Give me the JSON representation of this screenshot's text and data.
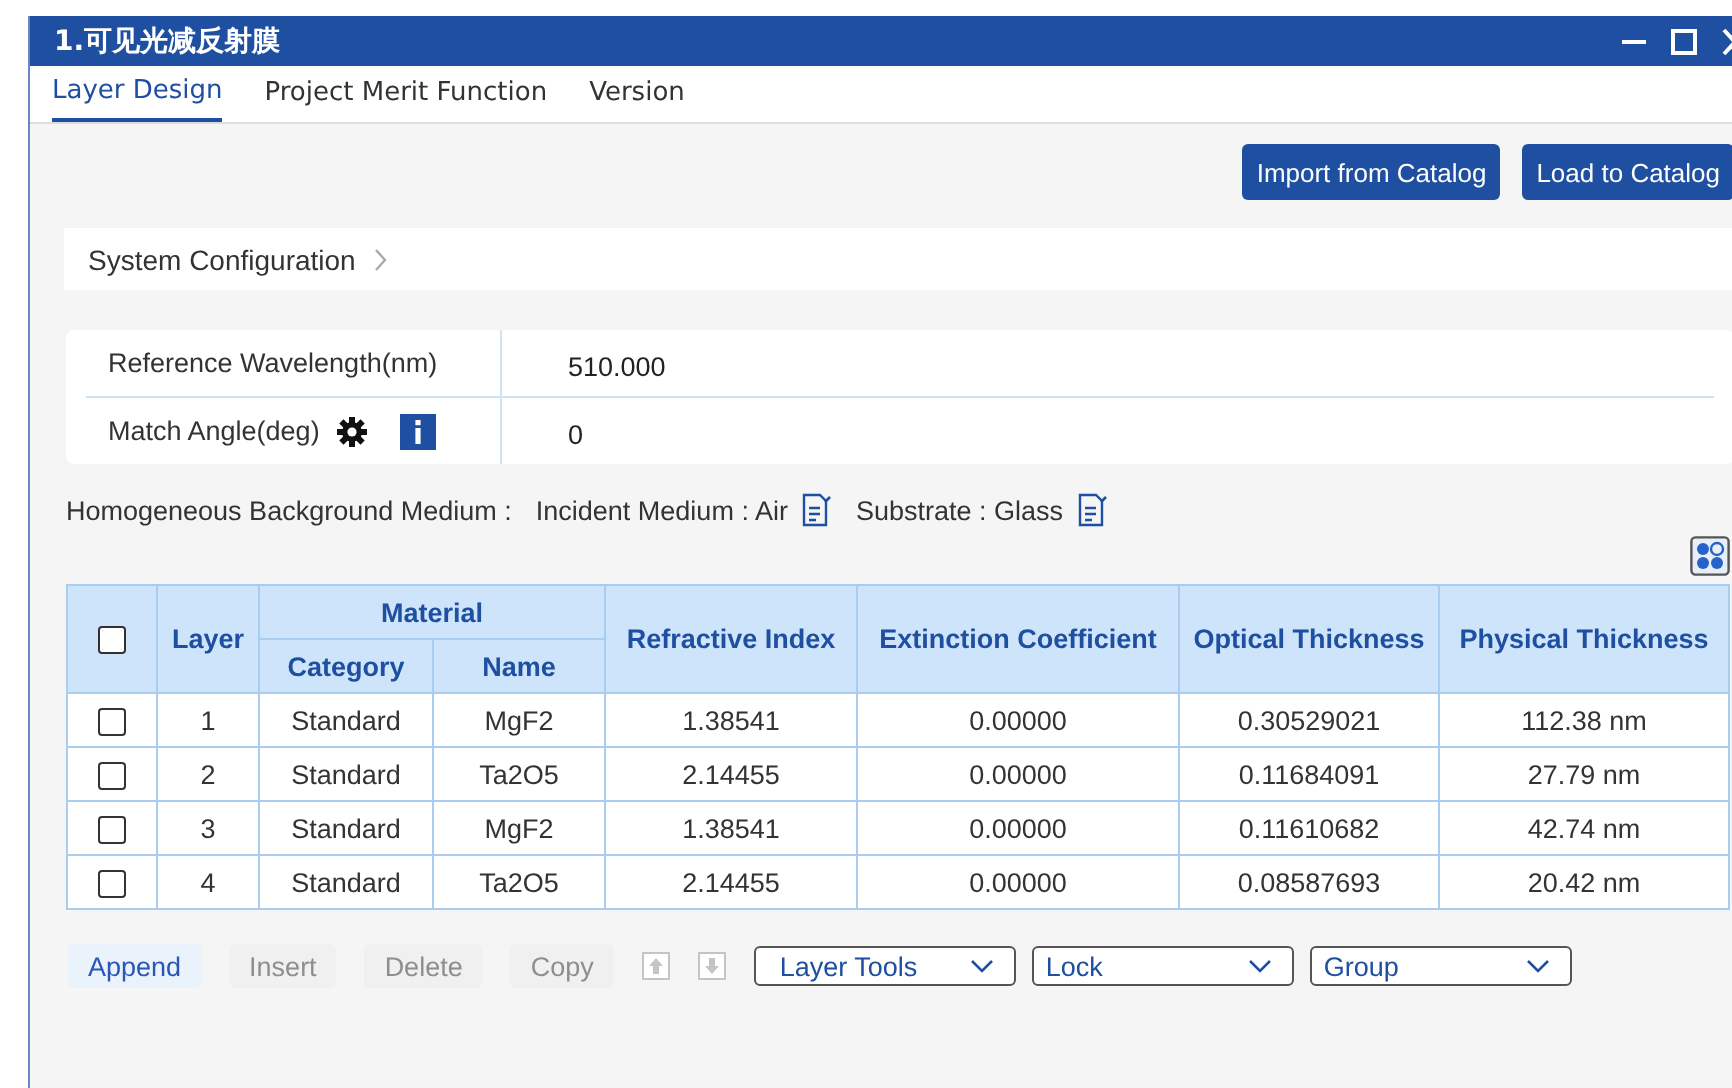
{
  "window": {
    "title": "1.可见光减反射膜"
  },
  "tabs": [
    {
      "label": "Layer Design",
      "selected": true
    },
    {
      "label": "Project Merit Function",
      "selected": false
    },
    {
      "label": "Version",
      "selected": false
    }
  ],
  "catalog_buttons": [
    "Import from Catalog",
    "Load to Catalog"
  ],
  "system_configuration": {
    "label": "System Configuration"
  },
  "parameters": [
    {
      "kind": "plain",
      "label": "Reference Wavelength(nm)",
      "value": "510.000"
    },
    {
      "kind": "angle",
      "label": "Match Angle(deg)",
      "value": "0"
    }
  ],
  "background_medium": {
    "label": "Homogeneous Background Medium :",
    "incident": "Incident Medium : Air",
    "substrate": "Substrate : Glass"
  },
  "table": {
    "header_checked": false,
    "headers": {
      "layer": "Layer",
      "material": "Material",
      "category": "Category",
      "name": "Name",
      "refractive_index": "Refractive Index",
      "extinction": "Extinction Coefficient",
      "optical": "Optical Thickness",
      "physical": "Physical Thickness"
    },
    "rows": [
      {
        "checked": false,
        "layer": "1",
        "category": "Standard",
        "name": "MgF2",
        "refractive_index": "1.38541",
        "extinction": "0.00000",
        "optical": "0.30529021",
        "physical": "112.38 nm"
      },
      {
        "checked": false,
        "layer": "2",
        "category": "Standard",
        "name": "Ta2O5",
        "refractive_index": "2.14455",
        "extinction": "0.00000",
        "optical": "0.11684091",
        "physical": "27.79 nm"
      },
      {
        "checked": false,
        "layer": "3",
        "category": "Standard",
        "name": "MgF2",
        "refractive_index": "1.38541",
        "extinction": "0.00000",
        "optical": "0.11610682",
        "physical": "42.74 nm"
      },
      {
        "checked": false,
        "layer": "4",
        "category": "Standard",
        "name": "Ta2O5",
        "refractive_index": "2.14455",
        "extinction": "0.00000",
        "optical": "0.08587693",
        "physical": "20.42 nm"
      }
    ]
  },
  "toolbar": {
    "actions": [
      {
        "label": "Append",
        "disabled": false
      },
      {
        "label": "Insert",
        "disabled": true
      },
      {
        "label": "Delete",
        "disabled": true
      },
      {
        "label": "Copy",
        "disabled": true
      }
    ],
    "move_buttons": [
      {
        "kind": "up",
        "disabled": true
      },
      {
        "kind": "down",
        "disabled": true
      }
    ],
    "dropdowns": [
      "Layer Tools",
      "Lock",
      "Group"
    ]
  }
}
